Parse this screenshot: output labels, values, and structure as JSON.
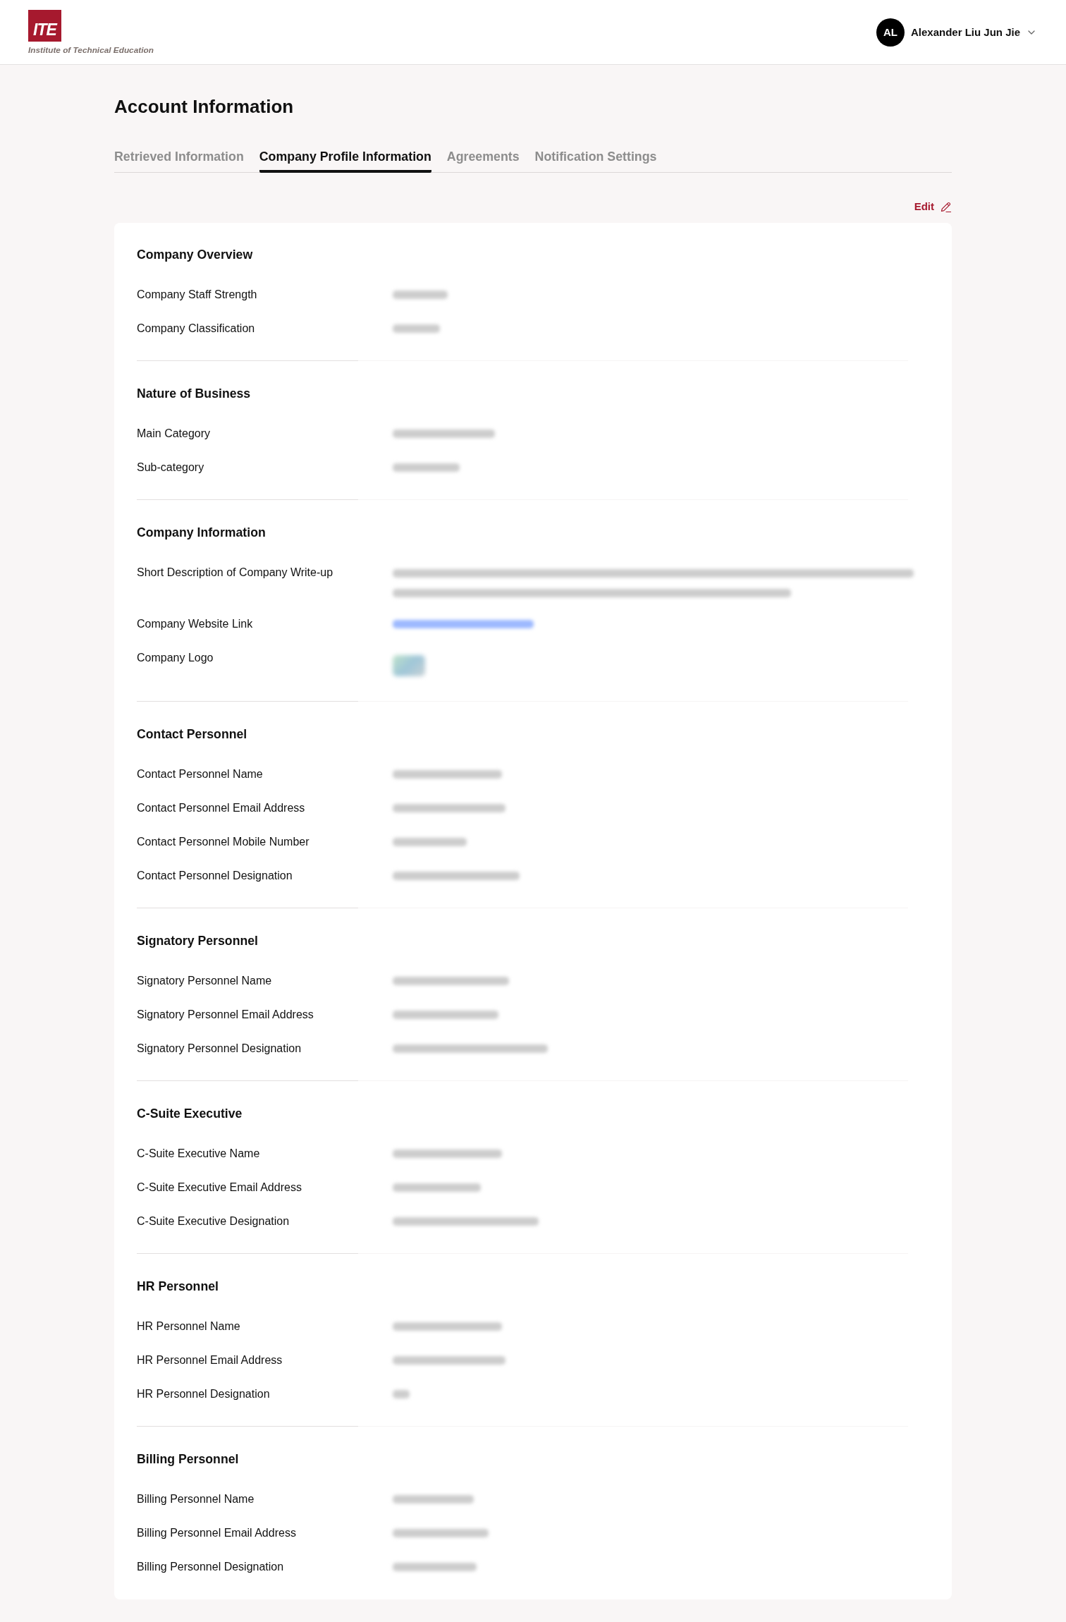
{
  "header": {
    "logo": {
      "mark": "ITE",
      "caption": "Institute of Technical Education"
    },
    "user": {
      "initials": "AL",
      "name": "Alexander Liu Jun Jie"
    }
  },
  "page": {
    "title": "Account Information",
    "tabs": [
      {
        "label": "Retrieved Information",
        "selected": false
      },
      {
        "label": "Company Profile Information",
        "selected": true
      },
      {
        "label": "Agreements",
        "selected": false
      },
      {
        "label": "Notification Settings",
        "selected": false
      }
    ],
    "edit_action": {
      "label": "Edit"
    }
  },
  "sections": [
    {
      "title": "Company Overview",
      "fields": [
        {
          "label": "Company Staff Strength",
          "kind": "redacted"
        },
        {
          "label": "Company Classification",
          "kind": "redacted"
        }
      ]
    },
    {
      "title": "Nature of Business",
      "fields": [
        {
          "label": "Main Category",
          "kind": "redacted"
        },
        {
          "label": "Sub-category",
          "kind": "redacted"
        }
      ]
    },
    {
      "title": "Company Information",
      "fields": [
        {
          "label": "Short Description of Company Write-up",
          "kind": "redacted_paragraph"
        },
        {
          "label": "Company Website Link",
          "kind": "redacted_link"
        },
        {
          "label": "Company Logo",
          "kind": "redacted_image"
        }
      ]
    },
    {
      "title": "Contact Personnel",
      "fields": [
        {
          "label": "Contact Personnel Name",
          "kind": "redacted"
        },
        {
          "label": "Contact Personnel Email Address",
          "kind": "redacted"
        },
        {
          "label": "Contact Personnel Mobile Number",
          "kind": "redacted"
        },
        {
          "label": "Contact Personnel Designation",
          "kind": "redacted"
        }
      ]
    },
    {
      "title": "Signatory Personnel",
      "fields": [
        {
          "label": "Signatory Personnel Name",
          "kind": "redacted"
        },
        {
          "label": "Signatory Personnel Email Address",
          "kind": "redacted"
        },
        {
          "label": "Signatory Personnel Designation",
          "kind": "redacted"
        }
      ]
    },
    {
      "title": "C-Suite Executive",
      "fields": [
        {
          "label": "C-Suite Executive Name",
          "kind": "redacted"
        },
        {
          "label": "C-Suite Executive Email Address",
          "kind": "redacted"
        },
        {
          "label": "C-Suite Executive Designation",
          "kind": "redacted"
        }
      ]
    },
    {
      "title": "HR Personnel",
      "fields": [
        {
          "label": "HR Personnel Name",
          "kind": "redacted"
        },
        {
          "label": "HR Personnel Email Address",
          "kind": "redacted"
        },
        {
          "label": "HR Personnel Designation",
          "kind": "redacted"
        }
      ]
    },
    {
      "title": "Billing Personnel",
      "fields": [
        {
          "label": "Billing Personnel Name",
          "kind": "redacted"
        },
        {
          "label": "Billing Personnel Email Address",
          "kind": "redacted"
        },
        {
          "label": "Billing Personnel Designation",
          "kind": "redacted"
        }
      ]
    }
  ]
}
